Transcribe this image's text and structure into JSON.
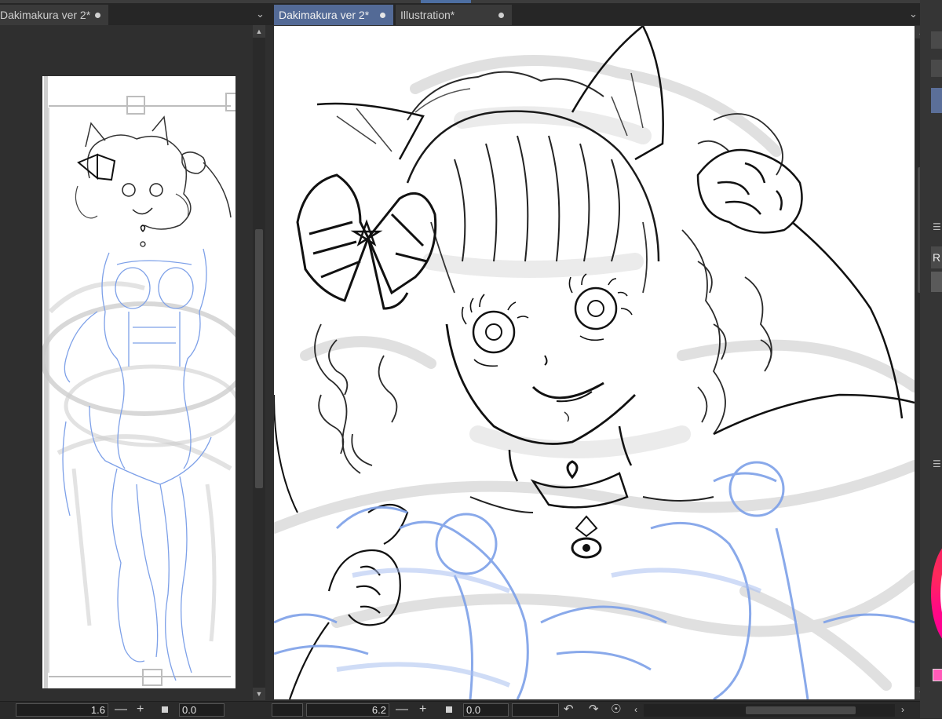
{
  "navigator": {
    "tab_label": "Dakimakura ver 2*",
    "zoom_value": "1.6",
    "rotation_value": "0.0"
  },
  "canvas": {
    "tabs": [
      {
        "label": "Dakimakura ver 2*",
        "active": true
      },
      {
        "label": "Illustration*",
        "active": false
      }
    ],
    "zoom_value": "6.2",
    "rotation_value": "0.0"
  },
  "right_dock": {
    "panel_letter": "R"
  },
  "icons": {
    "tab_menu": "chevron-down-icon",
    "unsaved": "modified-dot-icon",
    "zoom_out": "minus-icon",
    "zoom_in": "plus-icon",
    "fit": "square-icon",
    "rotate_left": "rotate-left-icon",
    "rotate_right": "rotate-right-icon",
    "reset_rotation": "reset-rotation-icon"
  },
  "colors": {
    "active_tab": "#536a96",
    "background": "#2f2f2f",
    "sketch_blue": "#7da0e8",
    "line_dark": "#1a1a1a",
    "color_wheel": "#ff0090"
  }
}
